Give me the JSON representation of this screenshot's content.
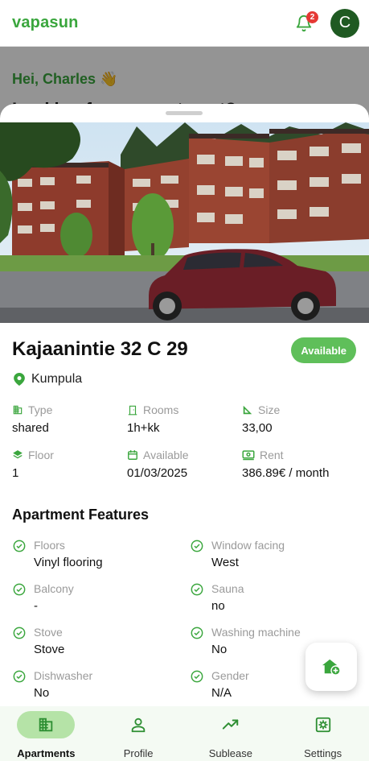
{
  "app": {
    "brand": "vapasun",
    "notification_count": "2",
    "avatar_initial": "C"
  },
  "background": {
    "greeting": "Hei, Charles 👋",
    "subtitle": "Looking for an apartment?"
  },
  "listing": {
    "title": "Kajaanintie 32 C 29",
    "status": "Available",
    "location": "Kumpula",
    "facts": [
      {
        "label": "Type",
        "value": "shared",
        "icon": "building-icon"
      },
      {
        "label": "Rooms",
        "value": "1h+kk",
        "icon": "door-icon"
      },
      {
        "label": "Size",
        "value": "33,00",
        "icon": "ruler-icon"
      },
      {
        "label": "Floor",
        "value": "1",
        "icon": "layers-icon"
      },
      {
        "label": "Available",
        "value": "01/03/2025",
        "icon": "calendar-icon"
      },
      {
        "label": "Rent",
        "value": "386.89€ / month",
        "icon": "money-icon"
      }
    ],
    "features_title": "Apartment Features",
    "features": [
      {
        "label": "Floors",
        "value": "Vinyl flooring"
      },
      {
        "label": "Window facing",
        "value": "West"
      },
      {
        "label": "Balcony",
        "value": "-"
      },
      {
        "label": "Sauna",
        "value": "no"
      },
      {
        "label": "Stove",
        "value": "Stove"
      },
      {
        "label": "Washing machine",
        "value": "No"
      },
      {
        "label": "Dishwasher",
        "value": "No"
      },
      {
        "label": "Gender",
        "value": "N/A"
      }
    ]
  },
  "nav": [
    {
      "label": "Apartments",
      "icon": "apartment-icon",
      "active": true
    },
    {
      "label": "Profile",
      "icon": "person-icon",
      "active": false
    },
    {
      "label": "Sublease",
      "icon": "trending-up-icon",
      "active": false
    },
    {
      "label": "Settings",
      "icon": "settings-icon",
      "active": false
    }
  ],
  "colors": {
    "brand_green": "#3aa63d",
    "badge_green": "#5fbf5a",
    "nav_active": "#b5e3a7",
    "avatar": "#1f5a22"
  }
}
